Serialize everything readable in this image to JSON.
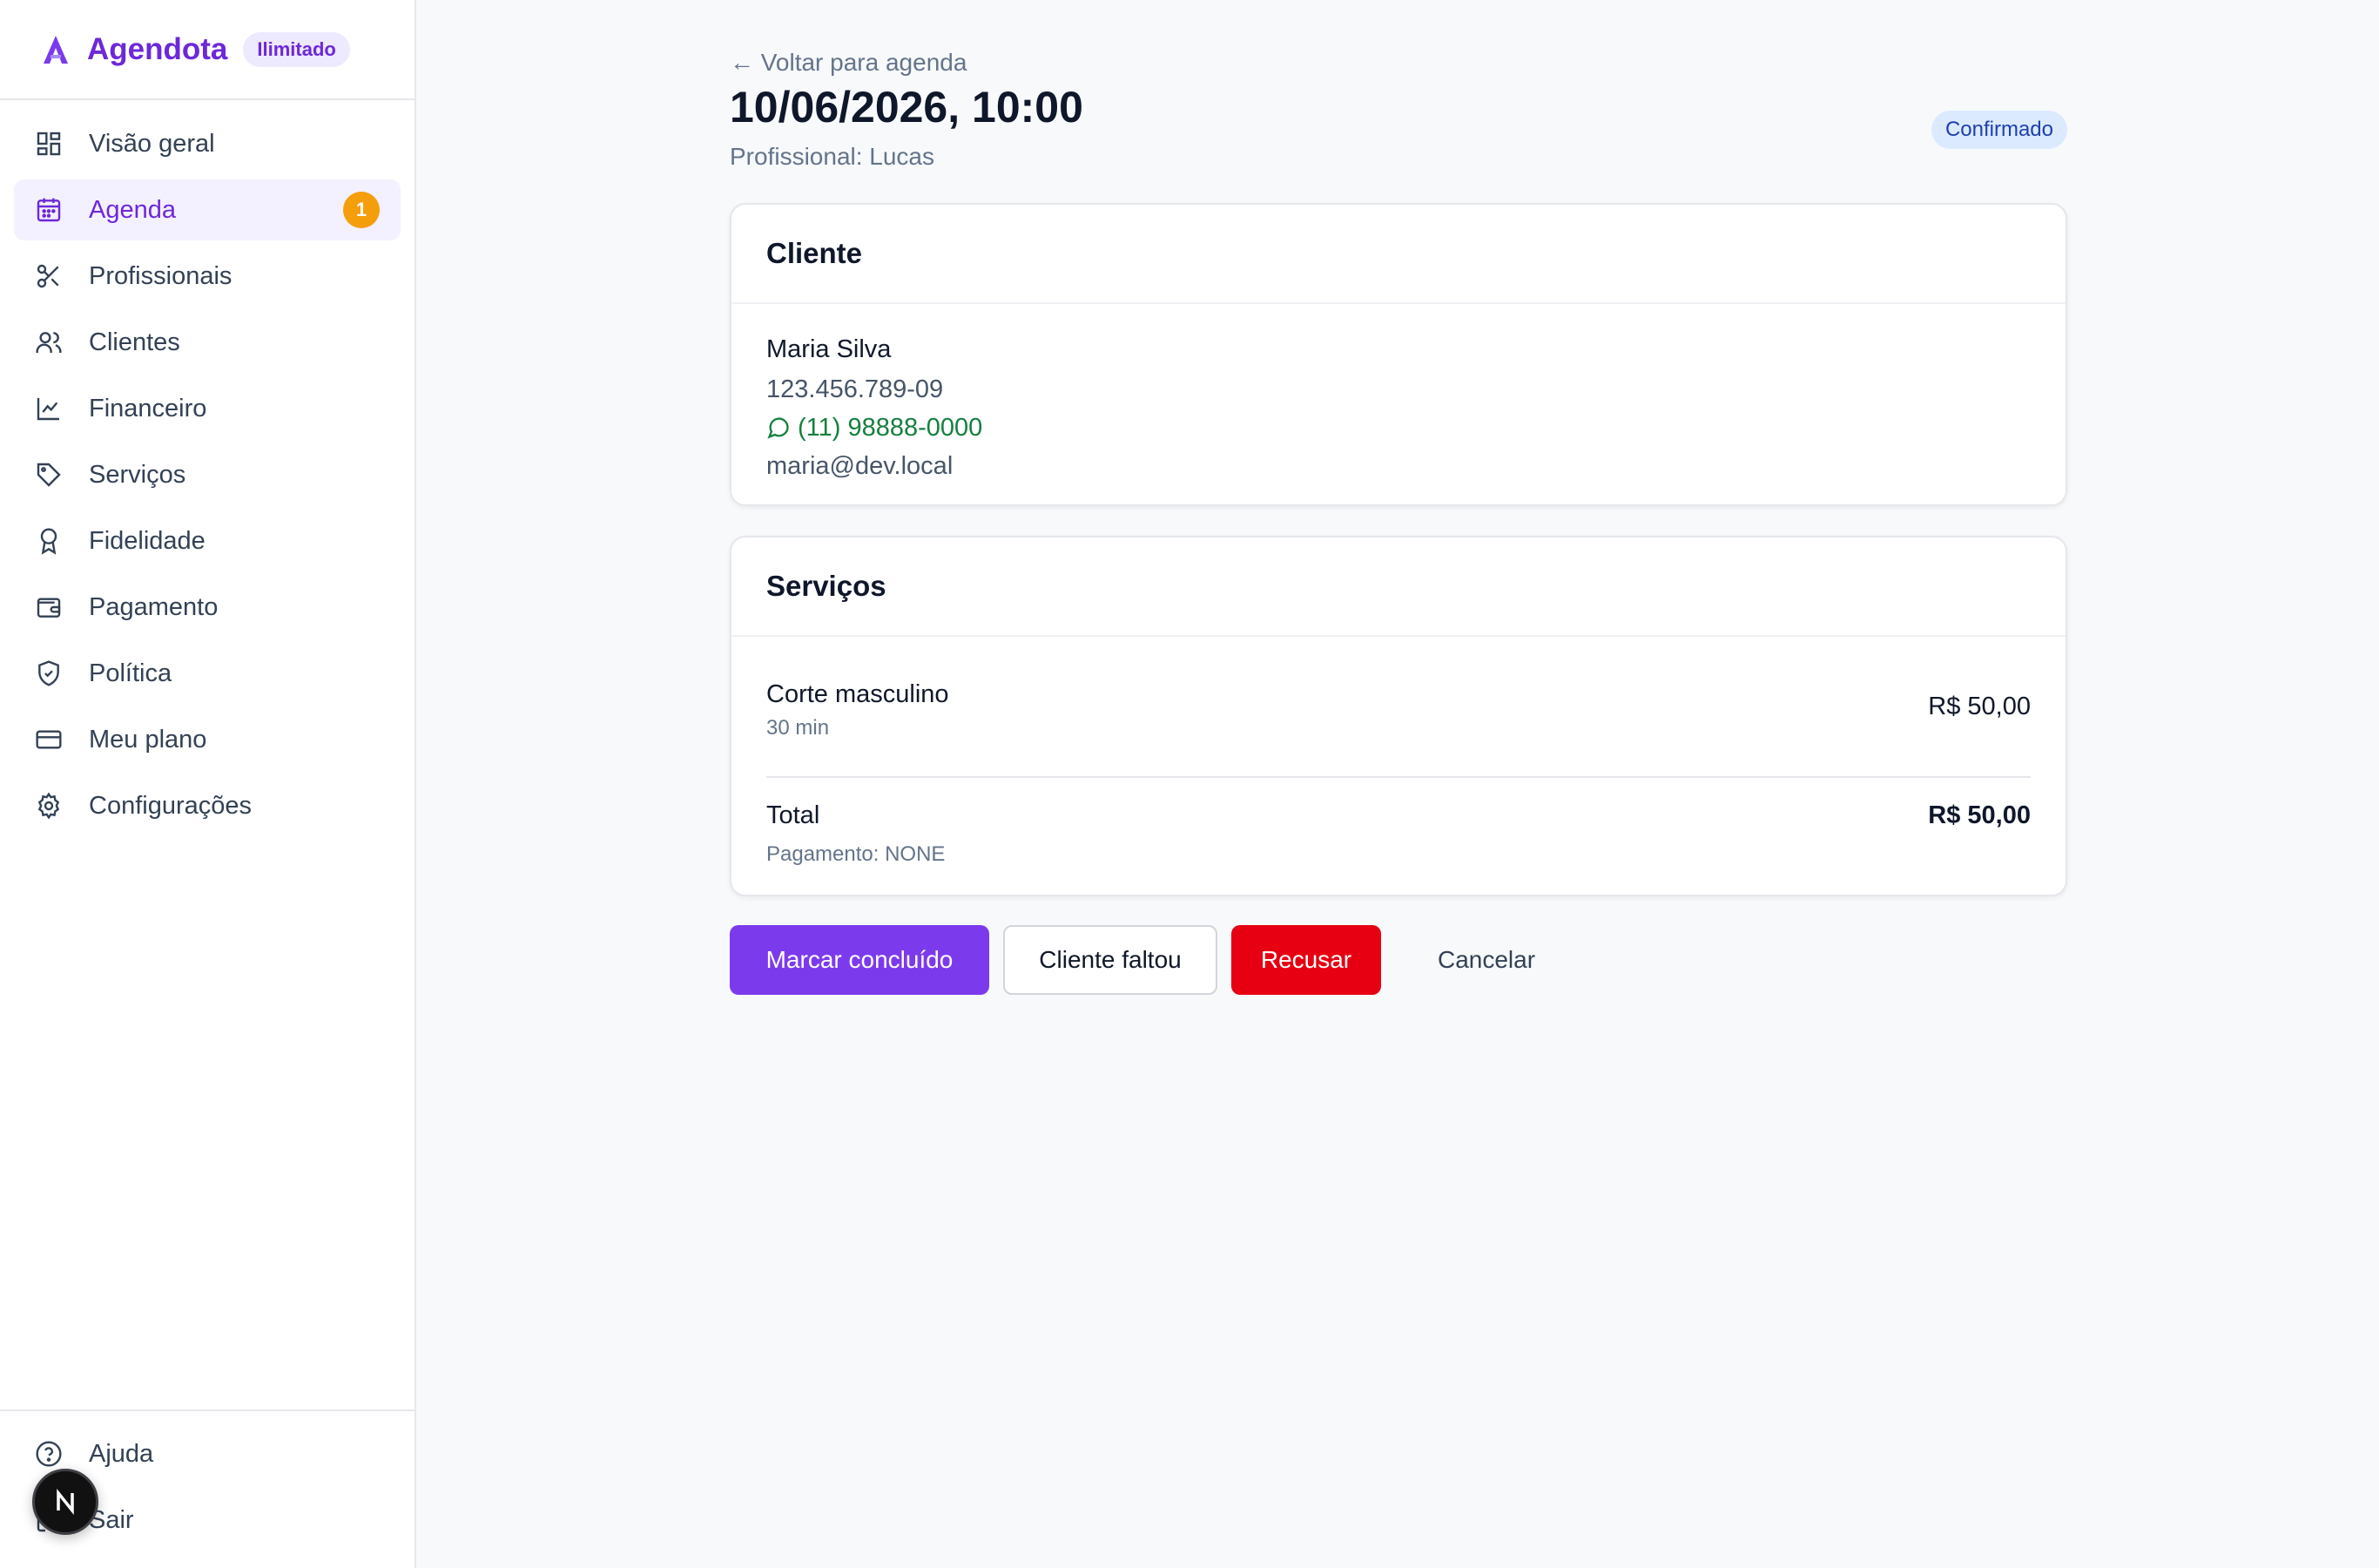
{
  "brand": {
    "name": "Agendota",
    "plan_badge": "Ilimitado"
  },
  "sidebar": {
    "items": [
      {
        "label": "Visão geral",
        "icon": "dashboard-grid-icon"
      },
      {
        "label": "Agenda",
        "icon": "calendar-icon",
        "active": true,
        "count": "1"
      },
      {
        "label": "Profissionais",
        "icon": "scissors-icon"
      },
      {
        "label": "Clientes",
        "icon": "users-icon"
      },
      {
        "label": "Financeiro",
        "icon": "line-chart-icon"
      },
      {
        "label": "Serviços",
        "icon": "tag-icon"
      },
      {
        "label": "Fidelidade",
        "icon": "award-icon"
      },
      {
        "label": "Pagamento",
        "icon": "wallet-icon"
      },
      {
        "label": "Política",
        "icon": "shield-check-icon"
      },
      {
        "label": "Meu plano",
        "icon": "credit-card-icon"
      },
      {
        "label": "Configurações",
        "icon": "gear-icon"
      }
    ],
    "bottom": [
      {
        "label": "Ajuda",
        "icon": "help-circle-icon"
      },
      {
        "label": "Sair",
        "icon": "logout-icon"
      }
    ],
    "next_badge_letter": "N"
  },
  "appointment": {
    "back_label": "← Voltar para agenda",
    "datetime": "10/06/2026, 10:00",
    "professional": "Profissional: Lucas",
    "status": "Confirmado"
  },
  "client": {
    "header": "Cliente",
    "name": "Maria Silva",
    "cpf": "123.456.789-09",
    "phone": "(11) 98888-0000",
    "email": "maria@dev.local"
  },
  "services": {
    "header": "Serviços",
    "items": [
      {
        "name": "Corte masculino",
        "duration": "30 min",
        "price": "R$ 50,00"
      }
    ],
    "total_label": "Total",
    "total_price": "R$ 50,00",
    "payment_note": "Pagamento: NONE"
  },
  "actions": {
    "complete": "Marcar concluído",
    "no_show": "Cliente faltou",
    "refuse": "Recusar",
    "cancel": "Cancelar"
  },
  "colors": {
    "accent": "#7c3aed",
    "danger": "#e60012",
    "success": "#15803d",
    "badge_count": "#f59e0b",
    "status_bg": "#dbeafe"
  }
}
